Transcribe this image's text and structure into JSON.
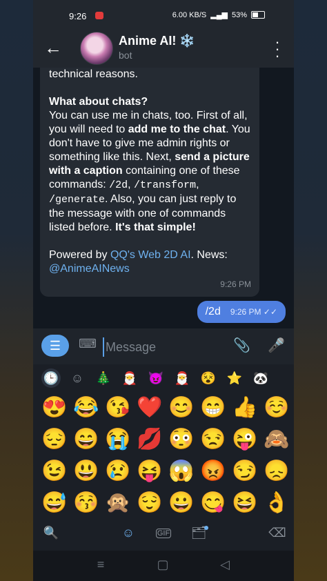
{
  "status_bar": {
    "time": "9:26",
    "network_speed": "6.00 KB/S",
    "battery": "53%"
  },
  "header": {
    "back_icon": "arrow-left-icon",
    "title": "Anime AI! ❄️",
    "subtitle": "bot",
    "menu_icon": "more-vertical-icon"
  },
  "chat": {
    "incoming": {
      "p1": "technical reasons.",
      "heading": "What about chats?",
      "body_1": "You can use me in chats, too. First of all, you will need to ",
      "body_bold_1": "add me to the chat",
      "body_2": ". You don't have to give me admin rights or something like this. Next, ",
      "body_bold_2": "send a picture with a caption",
      "body_3": " containing one of these commands: ",
      "cmd_1": "/2d",
      "sep_1": ", ",
      "cmd_2": "/transform",
      "sep_2": ", ",
      "cmd_3": "/generate",
      "body_4": ". Also, you can just reply to the message with one of commands listed before. ",
      "body_bold_3": "It's that simple!",
      "powered_prefix": "Powered by ",
      "powered_link": "QQ's Web 2D AI",
      "news_prefix": ". News: ",
      "news_link": "@AnimeAINews",
      "time": "9:26 PM"
    },
    "outgoing": {
      "text": "/2d",
      "time": "9:26 PM",
      "status_icon": "double-check-icon"
    }
  },
  "input": {
    "placeholder": "Message",
    "menu_icon": "menu-icon",
    "keyboard_icon": "keyboard-icon",
    "attach_icon": "paperclip-icon",
    "mic_icon": "microphone-icon"
  },
  "emoji_tabs": [
    "recent-icon",
    "smile-icon",
    "sticker-pack",
    "sticker-pack",
    "sticker-pack",
    "sticker-pack",
    "sticker-pack",
    "sticker-pack",
    "sticker-pack",
    "sticker-pack"
  ],
  "emoji_grid": [
    "😍",
    "😂",
    "😘",
    "❤️",
    "😊",
    "😁",
    "👍",
    "☺️",
    "😔",
    "😄",
    "😭",
    "💋",
    "😳",
    "😒",
    "😜",
    "🙈",
    "😉",
    "😃",
    "😢",
    "😝",
    "😱",
    "😡",
    "😏",
    "😞",
    "😅",
    "😚",
    "🙊",
    "😌",
    "😀",
    "😋",
    "😆",
    "👌"
  ],
  "emoji_bottom": {
    "search_icon": "search-icon",
    "emoji_icon": "smile-icon",
    "gif_label": "GIF",
    "sticker_icon": "sticker-icon",
    "backspace_icon": "backspace-icon"
  },
  "nav_bar": [
    "menu-nav-icon",
    "home-nav-icon",
    "back-nav-icon"
  ]
}
